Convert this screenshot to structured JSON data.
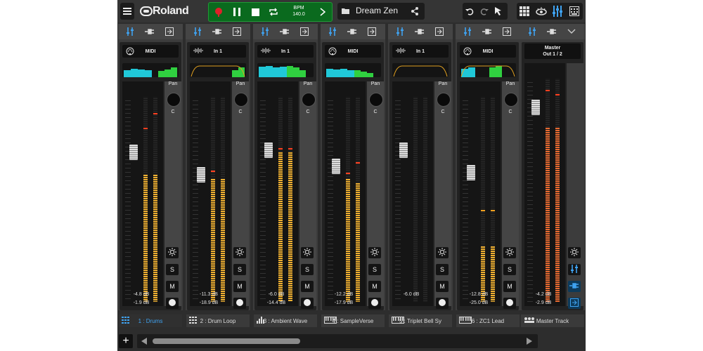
{
  "app": {
    "brand": "Roland",
    "song_title": "Dream Zen",
    "bpm_label": "BPM",
    "bpm_value": "140.0"
  },
  "colors": {
    "transport_bg": "#0a6a1e",
    "meter": "#f0b030",
    "peak": "#ff4020",
    "accent": "#3fa2f0",
    "record": "#e0202a",
    "eq_cyan": "#20c8d8",
    "eq_green": "#30d040",
    "eq_curve": "#e0a020"
  },
  "toolbar": {
    "menu_icon": "hamburger-icon",
    "record_icon": "record-icon",
    "pause_icon": "pause-icon",
    "stop_icon": "stop-icon",
    "loop_icon": "loop-icon",
    "next_icon": "chevron-right-icon",
    "folder_icon": "folder-icon",
    "share_icon": "share-icon",
    "undo_icon": "undo-icon",
    "redo_icon": "redo-icon",
    "select_icon": "cursor-icon",
    "grid_icon": "grid-icon",
    "view_icon": "eye-icon",
    "mixer_icon": "mixer-icon",
    "keyboard_icon": "keyboard-icon"
  },
  "channels": [
    {
      "source": "MIDI",
      "source_icon": "midi-icon",
      "pan_label": "Pan",
      "pan_value": "C",
      "db1": "-4.8 dB",
      "db2": "-1.9 dB",
      "name": "1 : Drums",
      "name_icon": "drum-grid-icon",
      "selected": true,
      "fader": 0.73,
      "levels": [
        0,
        0.62,
        0.62
      ],
      "peaks": [
        0,
        0.85,
        0.92
      ]
    },
    {
      "source": "In 1",
      "source_icon": "waveform-icon",
      "pan_label": "Pan",
      "pan_value": "C",
      "db1": "-11.3 dB",
      "db2": "-18.9 dB",
      "name": "2 : Drum Loop",
      "name_icon": "drum-grid-icon",
      "selected": false,
      "fader": 0.62,
      "levels": [
        0,
        0.6,
        0.6
      ],
      "peaks": [
        0,
        0.64,
        0
      ],
      "dim": true
    },
    {
      "source": "In 1",
      "source_icon": "waveform-icon",
      "pan_label": "Pan",
      "pan_value": "C",
      "db1": "-6.0 dB",
      "db2": "-14.4 dB",
      "name": "3 : Ambient Wave",
      "name_icon": "bars-icon",
      "selected": false,
      "fader": 0.74,
      "levels": [
        0,
        0.73,
        0.73
      ],
      "peaks": [
        0,
        0.75,
        0.75
      ]
    },
    {
      "source": "MIDI",
      "source_icon": "midi-icon",
      "pan_label": "Pan",
      "pan_value": "C",
      "db1": "-12.2 dB",
      "db2": "-17.9 dB",
      "name": "4 : SampleVerse",
      "name_icon": "keys-icon",
      "selected": false,
      "fader": 0.66,
      "levels": [
        0,
        0.6,
        0.58
      ],
      "peaks": [
        0,
        0.63,
        0.68
      ]
    },
    {
      "source": "In 1",
      "source_icon": "waveform-icon",
      "pan_label": "Pan",
      "pan_value": "C",
      "db1": "-6.0 dB",
      "db2": "",
      "name": "5 : Triplet Bell Sy",
      "name_icon": "keys-icon",
      "selected": false,
      "fader": 0.74,
      "levels": [
        0,
        0,
        0
      ],
      "peaks": [
        0,
        0,
        0
      ]
    },
    {
      "source": "MIDI",
      "source_icon": "midi-icon",
      "pan_label": "Pan",
      "pan_value": "C",
      "db1": "-12.8 dB",
      "db2": "-25.0 dB",
      "name": "6 : ZC1 Lead",
      "name_icon": "keys-icon",
      "selected": false,
      "fader": 0.63,
      "levels": [
        0,
        0.27,
        0.27
      ],
      "peaks": [
        0,
        0.45,
        0.45
      ]
    },
    {
      "source": "Master",
      "source2": "Out 1 / 2",
      "source_icon": "",
      "pan_label": "",
      "pan_value": "",
      "db1": "-4.2 dB",
      "db2": "-2.9 dB",
      "name": "Master Track",
      "name_icon": "master-icon",
      "selected": false,
      "fader": 0.87,
      "levels": [
        0,
        0.78,
        0.78
      ],
      "peaks": [
        0,
        0.95,
        0.93
      ],
      "master": true
    }
  ],
  "strip_header_icons": [
    "mixer-icon",
    "plug-icon",
    "output-icon"
  ],
  "strip_buttons": {
    "fx_icon": "fx-icon",
    "solo": "S",
    "mute": "M",
    "rec_monitor_icon": "circle-icon"
  },
  "bottom": {
    "add_icon": "plus-icon",
    "left_icon": "triangle-left-icon",
    "right_icon": "triangle-right-icon",
    "collapse_icon": "chevron-down-icon"
  }
}
